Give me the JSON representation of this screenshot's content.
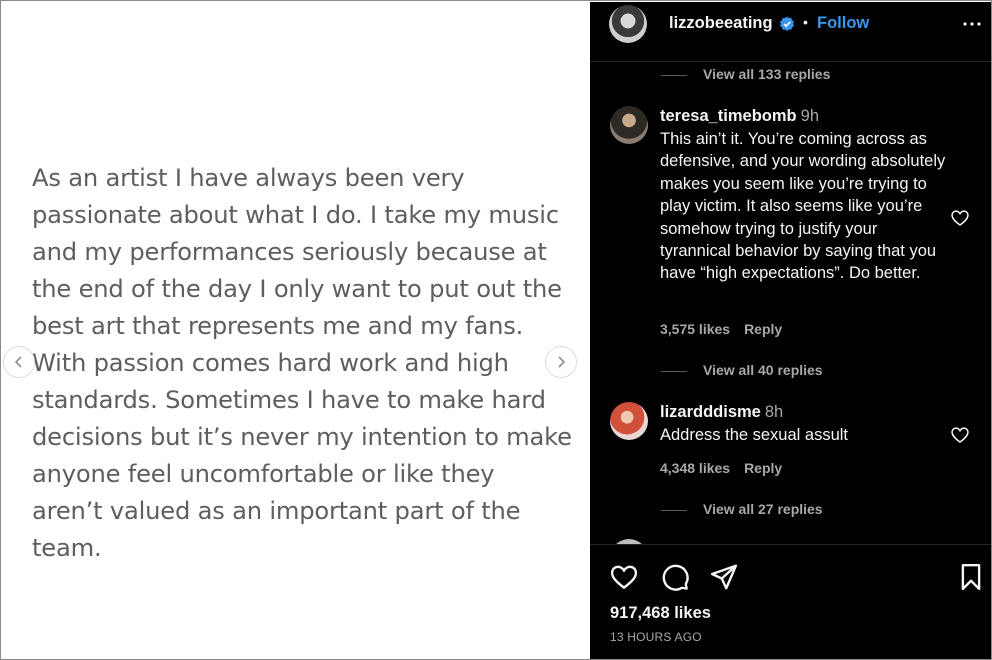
{
  "post": {
    "text": "As an artist I have always been very passionate about what I do. I take my music and my performances seriously because at the end of the day I only want to put out the best art that represents me and my fans. With passion comes hard work and high standards. Sometimes I have to make hard decisions but it’s never my intention to make anyone feel uncomfortable or like they aren’t valued as an important part of the team."
  },
  "header": {
    "username": "lizzobeeating",
    "separator": "•",
    "follow_label": "Follow"
  },
  "comments": {
    "top_view_replies": "View all 133 replies",
    "items": [
      {
        "username": "teresa_timebomb",
        "time": "9h",
        "text": "This ain’t it. You’re coming across as defensive, and your wording absolutely makes you seem like you’re trying to play victim. It also seems like you’re somehow trying to justify your tyrannical behavior by saying that you have “high expectations”. Do better.",
        "likes": "3,575 likes",
        "reply_label": "Reply",
        "view_replies": "View all 40 replies"
      },
      {
        "username": "lizardddisme",
        "time": "8h",
        "text": "Address the sexual assult",
        "likes": "4,348 likes",
        "reply_label": "Reply",
        "view_replies": "View all 27 replies"
      }
    ]
  },
  "footer": {
    "likes": "917,468 likes",
    "time_ago": "13 HOURS AGO"
  },
  "icons": {
    "verified": "verified-badge-icon",
    "more": "more-options-icon",
    "like": "heart-icon",
    "comment": "comment-bubble-icon",
    "share": "paper-plane-icon",
    "save": "bookmark-icon"
  },
  "colors": {
    "follow": "#3797f0",
    "panel_bg": "#000000",
    "muted_text": "#a8a8a8",
    "post_text": "#5e5e5e"
  }
}
